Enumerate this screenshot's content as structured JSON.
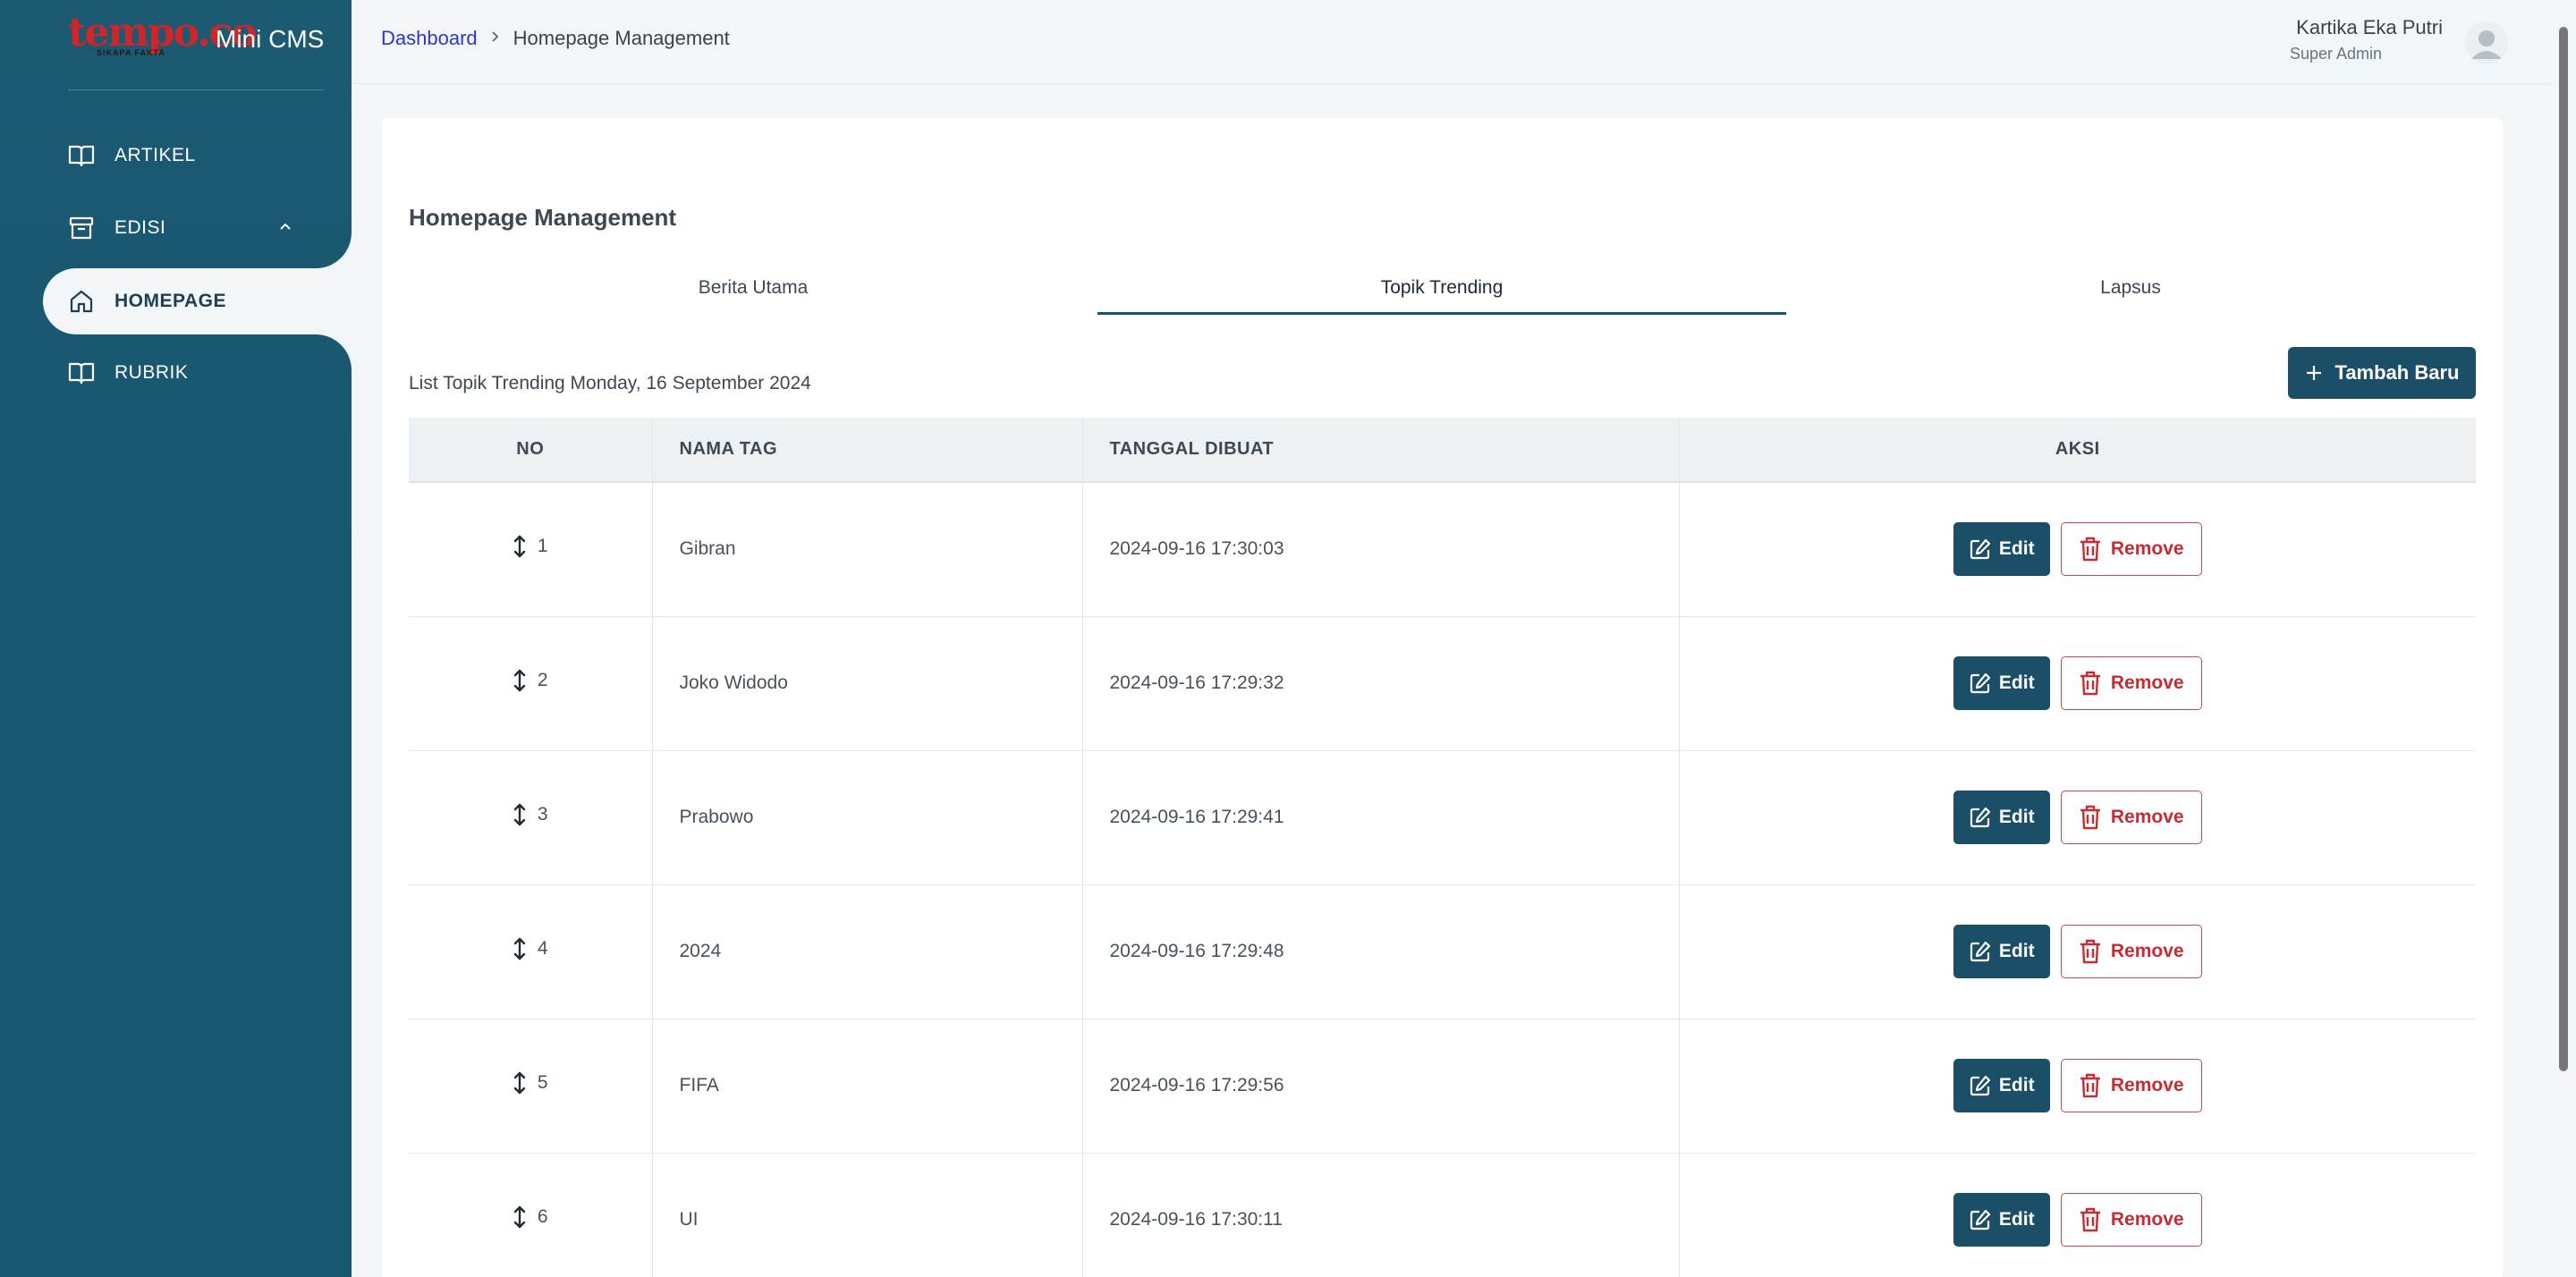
{
  "brand": {
    "logo": "tempo.co",
    "tagline": "SIKAPA FAKTA",
    "app_name": "Mini CMS"
  },
  "sidebar": {
    "items": [
      {
        "label": "ARTIKEL",
        "icon": "book-open-icon",
        "active": false
      },
      {
        "label": "EDISI",
        "icon": "archive-box-icon",
        "active": false,
        "expanded": true
      },
      {
        "label": "HOMEPAGE",
        "icon": "home-icon",
        "active": true
      },
      {
        "label": "RUBRIK",
        "icon": "book-open-icon",
        "active": false
      }
    ]
  },
  "header": {
    "breadcrumb": {
      "root": "Dashboard",
      "current": "Homepage Management"
    },
    "user": {
      "name": "Kartika Eka Putri",
      "role": "Super Admin"
    }
  },
  "main": {
    "heading": "Homepage Management",
    "tabs": [
      {
        "label": "Berita Utama",
        "active": false
      },
      {
        "label": "Topik Trending",
        "active": true
      },
      {
        "label": "Lapsus",
        "active": false
      }
    ],
    "list_caption": "List Topik Trending Monday, 16 September 2024",
    "add_button": "Tambah Baru",
    "table": {
      "headers": [
        "NO",
        "NAMA TAG",
        "TANGGAL DIBUAT",
        "AKSI"
      ],
      "rows": [
        {
          "no": "1",
          "tag": "Gibran",
          "date": "2024-09-16 17:30:03"
        },
        {
          "no": "2",
          "tag": "Joko Widodo",
          "date": "2024-09-16 17:29:32"
        },
        {
          "no": "3",
          "tag": "Prabowo",
          "date": "2024-09-16 17:29:41"
        },
        {
          "no": "4",
          "tag": "2024",
          "date": "2024-09-16 17:29:48"
        },
        {
          "no": "5",
          "tag": "FIFA",
          "date": "2024-09-16 17:29:56"
        },
        {
          "no": "6",
          "tag": "UI",
          "date": "2024-09-16 17:30:11"
        }
      ],
      "edit_label": "Edit",
      "remove_label": "Remove"
    }
  },
  "colors": {
    "sidebar_bg": "#1a5870",
    "primary": "#1a4f67",
    "danger": "#c62c34",
    "link": "#2d37c4",
    "logo_red": "#d0252b"
  }
}
